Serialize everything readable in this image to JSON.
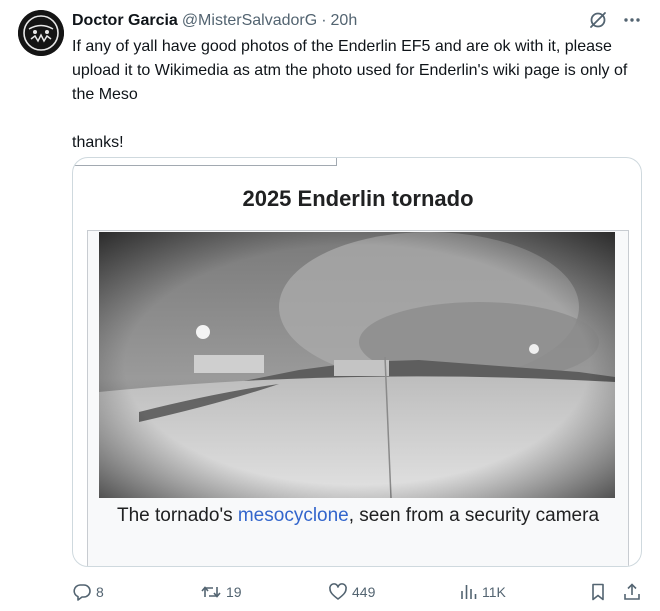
{
  "author": {
    "display_name": "Doctor Garcia",
    "handle": "@MisterSalvadorG",
    "separator": "·",
    "time": "20h"
  },
  "tweet": {
    "paragraph_1": "If any of yall have good photos of the Enderlin EF5 and are ok with it, please upload it to Wikimedia as atm the photo used for Enderlin's wiki page is only of the Meso",
    "paragraph_2": "thanks!"
  },
  "card": {
    "title": "2025 Enderlin tornado",
    "caption_before": "The tornado's ",
    "caption_link": "mesocyclone",
    "caption_after": ", seen from a security camera"
  },
  "metrics": {
    "replies": "8",
    "retweets": "19",
    "likes": "449",
    "views": "11K"
  },
  "icons": {
    "reply": "reply-icon",
    "retweet": "retweet-icon",
    "like": "heart-icon",
    "views": "views-icon",
    "bookmark": "bookmark-icon",
    "share": "share-icon",
    "grok": "grok-icon",
    "more": "more-icon"
  },
  "colors": {
    "text": "#0f1419",
    "secondary": "#536471",
    "wiki_link": "#3366cc",
    "border": "#cfd9de"
  }
}
